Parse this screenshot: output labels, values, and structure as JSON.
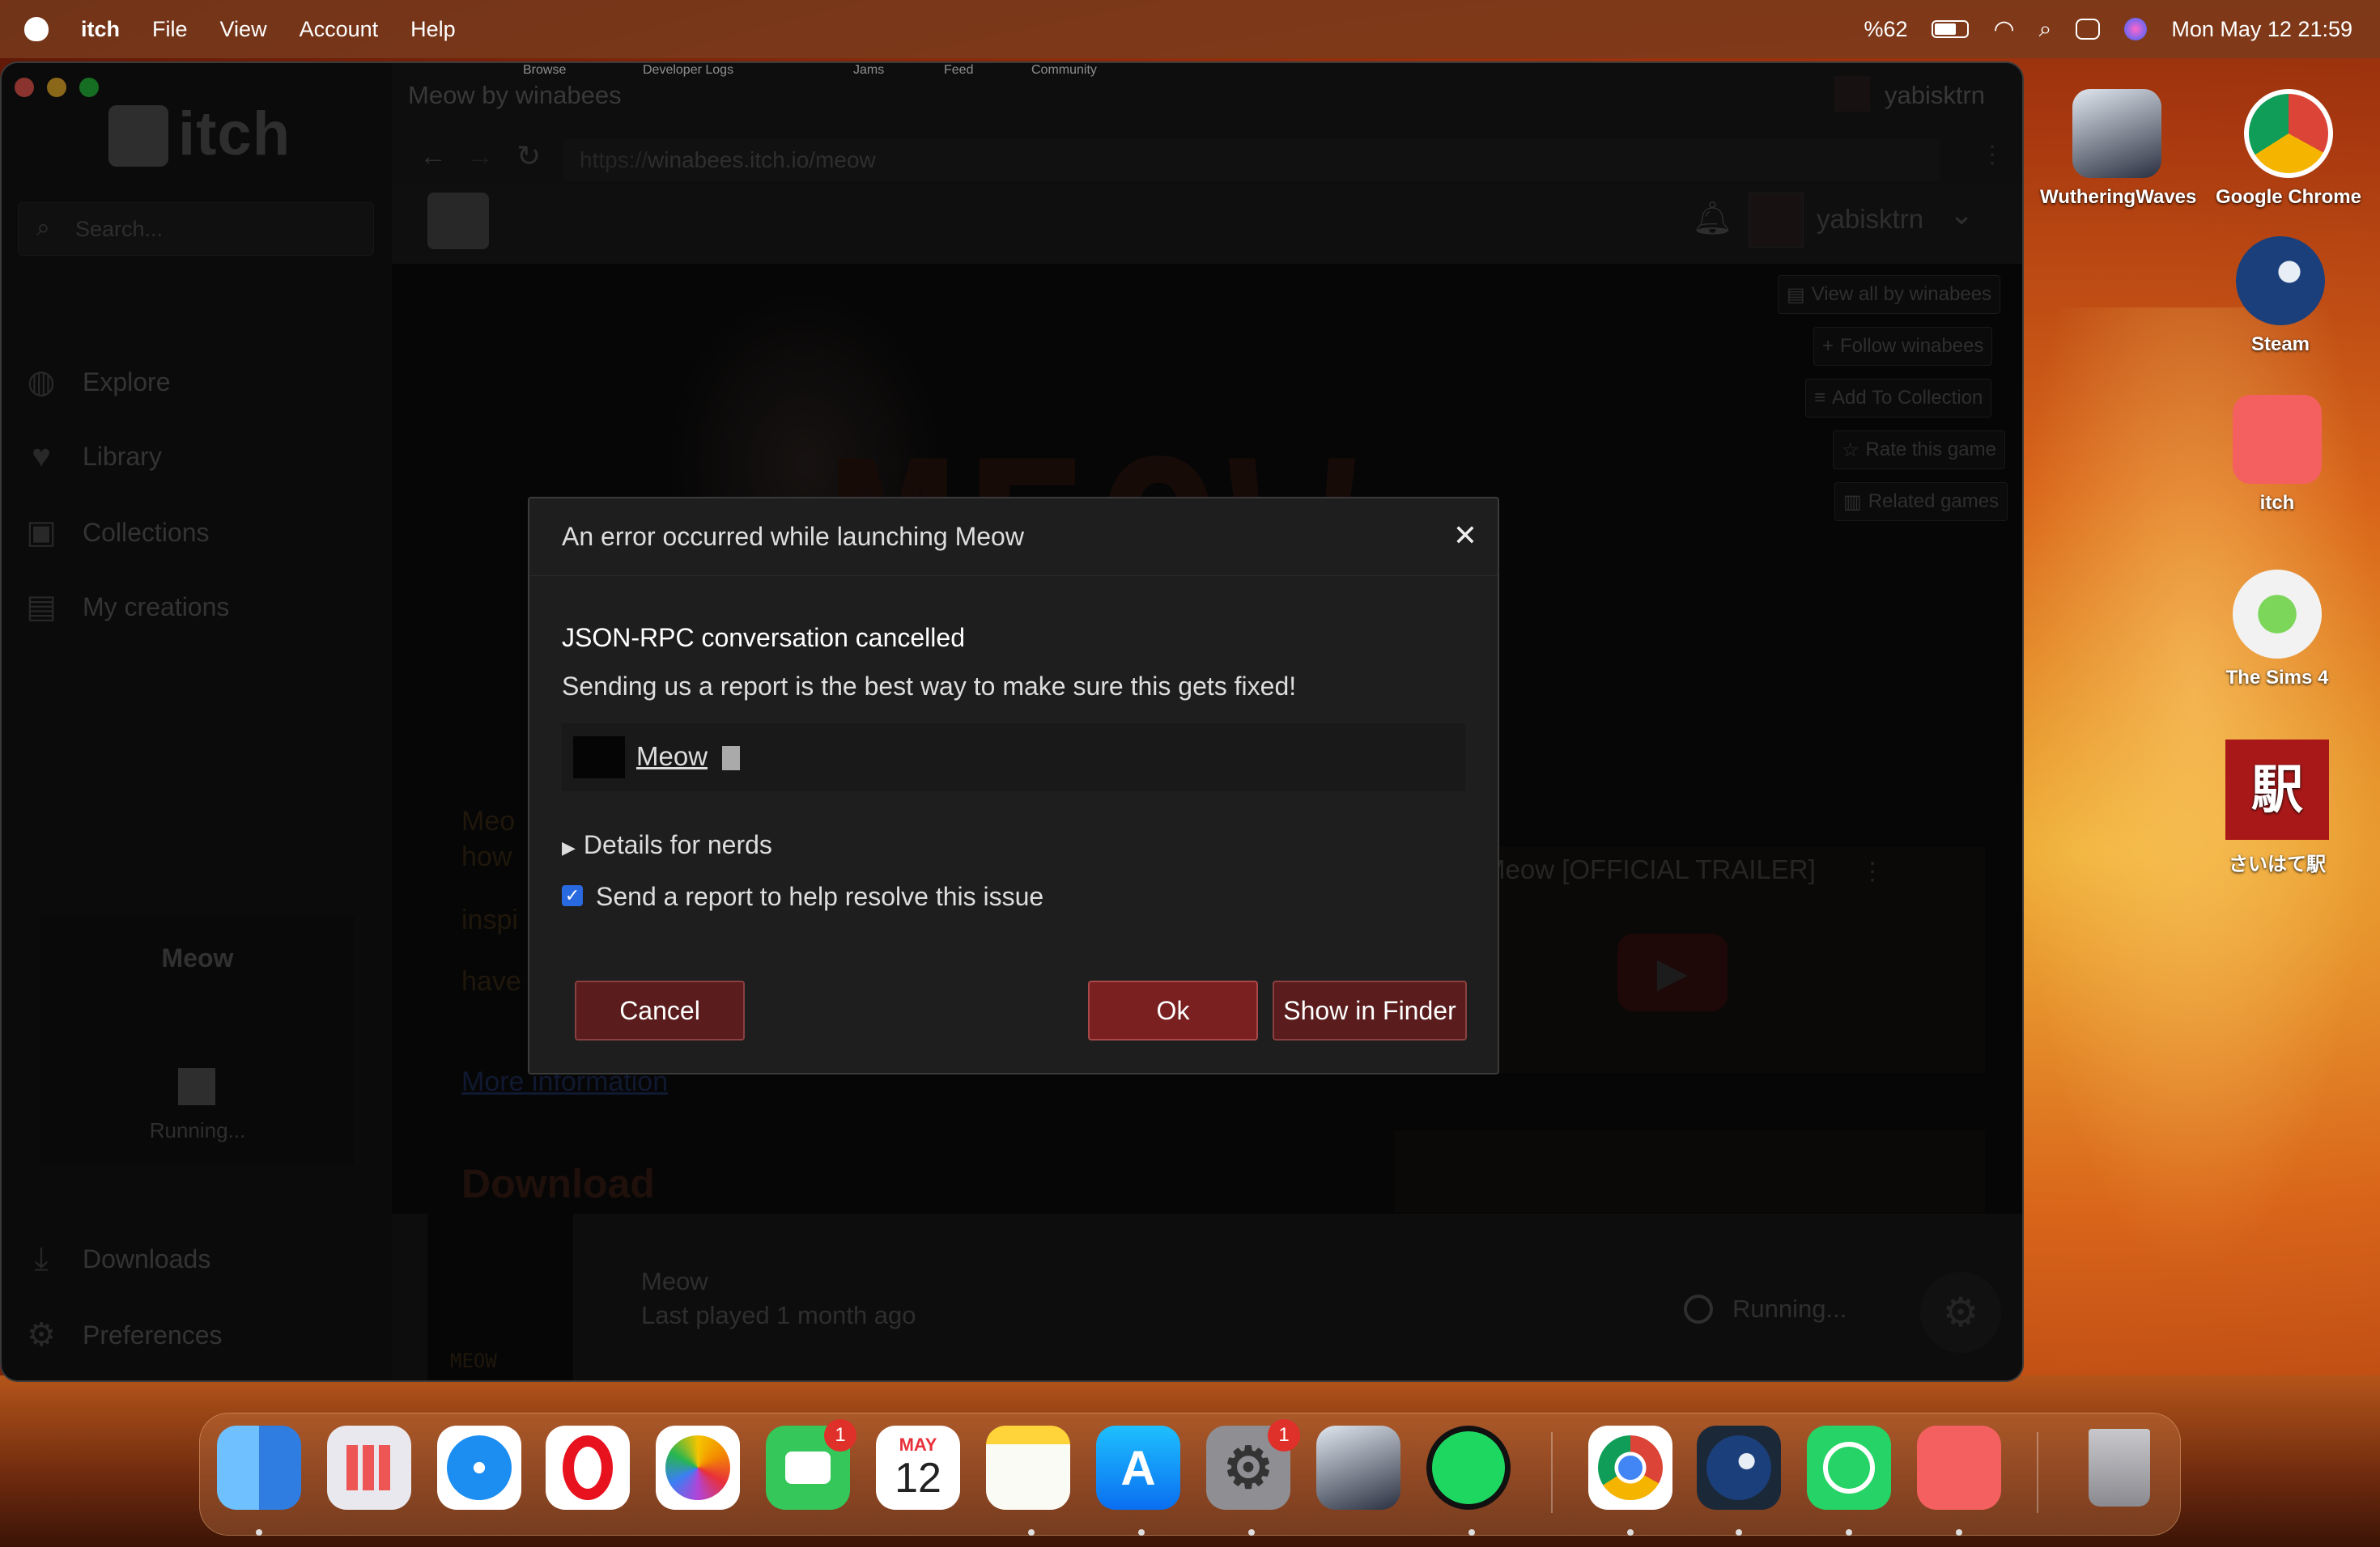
{
  "menubar": {
    "app": "itch",
    "items": [
      "File",
      "View",
      "Account",
      "Help"
    ],
    "battery": "%62",
    "clock": "Mon May 12  21:59"
  },
  "window": {
    "sidebar": {
      "logo": "itch",
      "search_placeholder": "Search...",
      "nav": [
        "Explore",
        "Library",
        "Collections",
        "My creations"
      ],
      "bottom_nav": [
        "Downloads",
        "Preferences"
      ],
      "running": {
        "title": "Meow",
        "status": "Running..."
      }
    },
    "title": "Meow by winabees",
    "user": "yabisktrn",
    "url_scheme": "https://",
    "url_rest": "winabees.itch.io/meow",
    "itch_nav": [
      "Browse",
      "Developer Logs",
      "Jams",
      "Feed",
      "Community"
    ],
    "page_buttons": [
      "View all by winabees",
      "Follow winabees",
      "Add To Collection",
      "Rate this game",
      "Related games"
    ],
    "page_title_art": "MEOW",
    "desc_fragments": [
      "Meo",
      "how",
      "inspi",
      "have"
    ],
    "more_info": "More information",
    "video_title": "Meow [OFFICIAL TRAILER]",
    "download_heading": "Download",
    "bottom": {
      "game": "Meow",
      "last_played": "Last played 1 month ago",
      "status": "Running...",
      "thumb_label": "MEOW"
    }
  },
  "dialog": {
    "title": "An error occurred while launching Meow",
    "heading": "JSON-RPC conversation cancelled",
    "message": "Sending us a report is the best way to make sure this gets fixed!",
    "game_link": "Meow",
    "details": "Details for nerds",
    "checkbox_label": "Send a report to help resolve this issue",
    "checkbox_checked": true,
    "buttons": {
      "cancel": "Cancel",
      "ok": "Ok",
      "finder": "Show in Finder"
    }
  },
  "desktop": [
    "WutheringWaves",
    "Google Chrome",
    "Steam",
    "itch",
    "The Sims 4",
    "さいはて駅"
  ],
  "dock": {
    "calendar_month": "MAY",
    "calendar_day": "12",
    "badges": {
      "facetime": "1",
      "settings": "1"
    }
  },
  "colors": {
    "accent": "#7a2020",
    "checkbox": "#2a6ae0"
  }
}
